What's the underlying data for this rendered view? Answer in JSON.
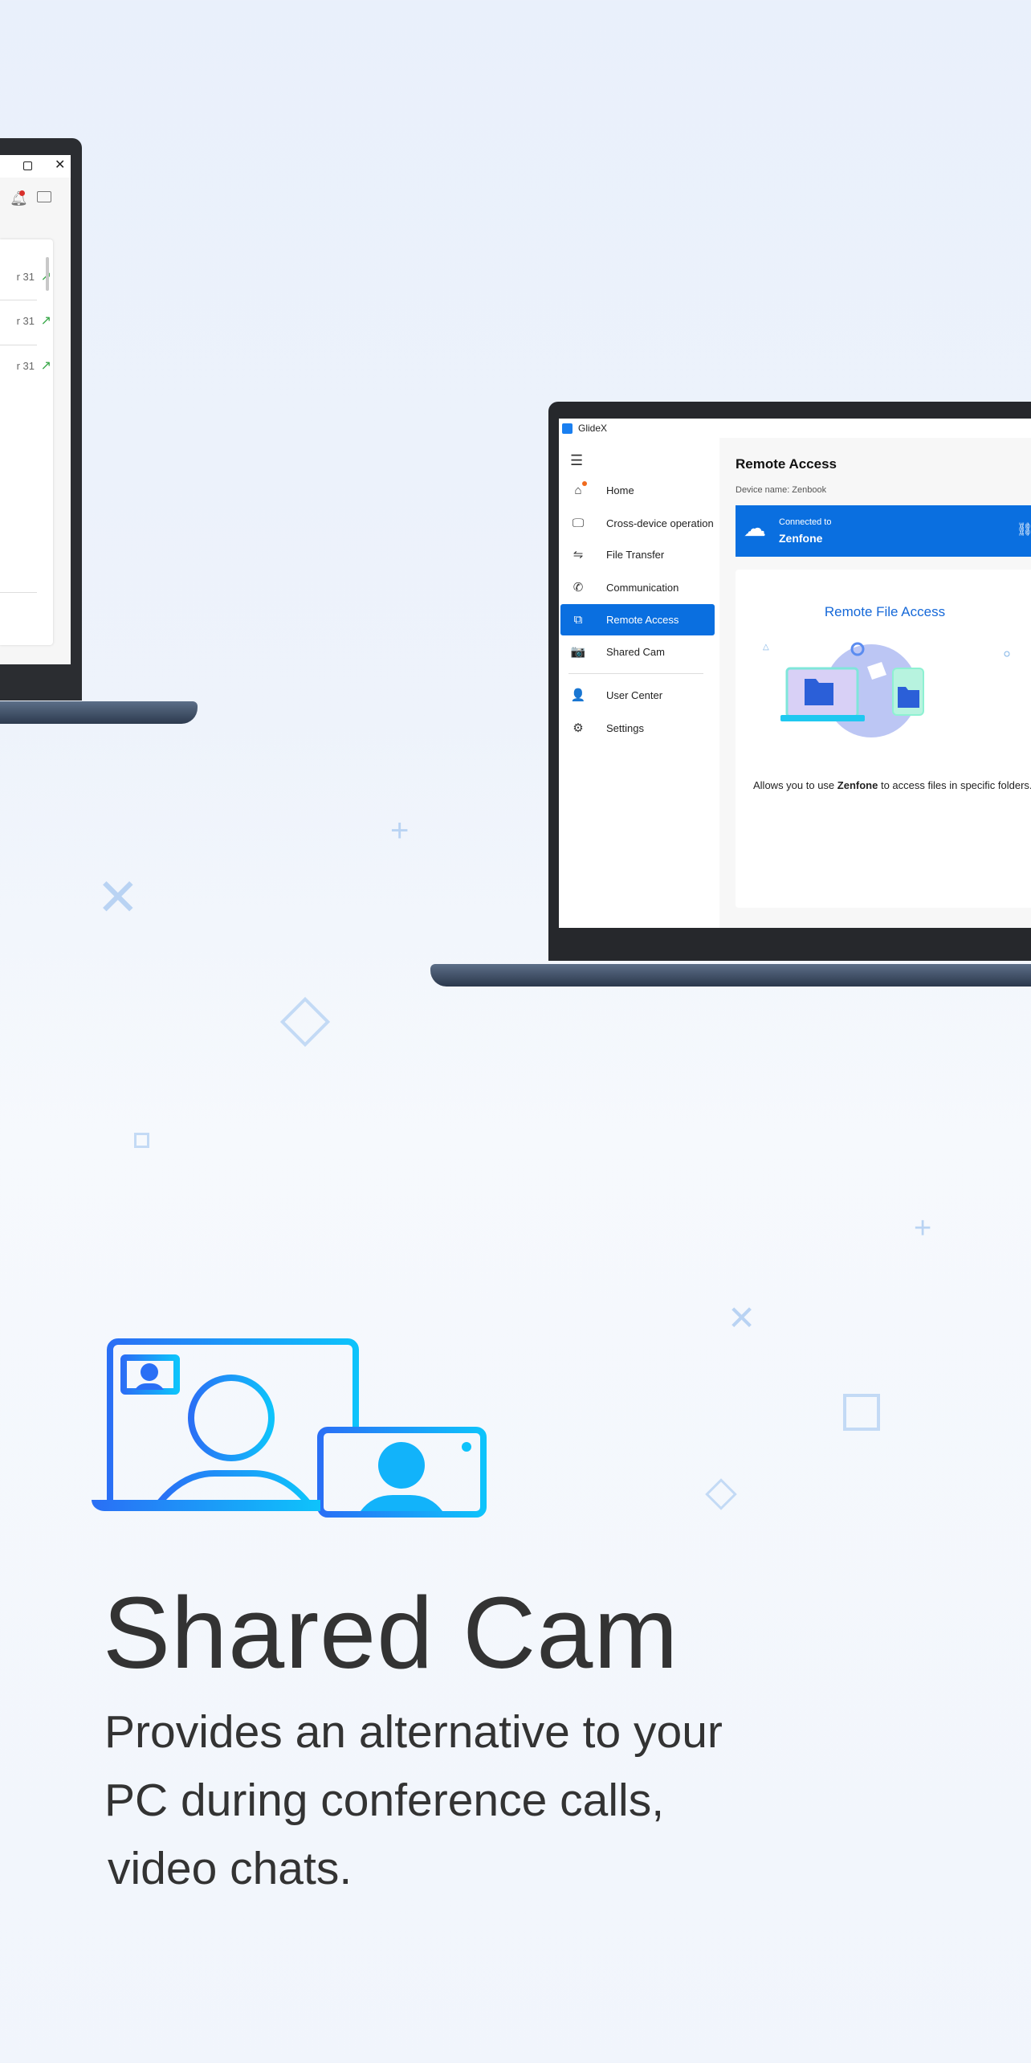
{
  "left_window": {
    "window_controls": [
      "maximize-icon",
      "close-icon"
    ],
    "toolbar_icons": [
      "bell-icon",
      "feedback-icon"
    ],
    "rows": [
      {
        "date": "r 31"
      },
      {
        "date": "r 31"
      },
      {
        "date": "r 31"
      }
    ],
    "arrow_glyph": "↗"
  },
  "app": {
    "title": "GlideX",
    "sidebar": {
      "items": [
        {
          "label": "Home",
          "icon": "⌂"
        },
        {
          "label": "Cross-device operation",
          "icon": "🖵"
        },
        {
          "label": "File Transfer",
          "icon": "⇋"
        },
        {
          "label": "Communication",
          "icon": "✆"
        },
        {
          "label": "Remote Access",
          "icon": "⧉",
          "active": true
        },
        {
          "label": "Shared Cam",
          "icon": "📷"
        }
      ],
      "bottom_items": [
        {
          "label": "User Center",
          "icon": "👤"
        },
        {
          "label": "Settings",
          "icon": "⚙"
        }
      ]
    },
    "main": {
      "title": "Remote Access",
      "device_name": "Device name: Zenbook",
      "banner": {
        "connected_label": "Connected to",
        "device": "Zenfone"
      },
      "card_title": "Remote File Access",
      "caption_pre": "Allows you to use ",
      "caption_bold": "Zenfone",
      "caption_post": " to access files in specific folders."
    },
    "accent": "#0a6fe0"
  },
  "feature": {
    "title": "Shared Cam",
    "description_lines": [
      "Provides an alternative to your",
      "PC during conference calls,",
      "video chats."
    ],
    "icon_gradient": [
      "#2a6ff5",
      "#0ec3fb"
    ]
  }
}
